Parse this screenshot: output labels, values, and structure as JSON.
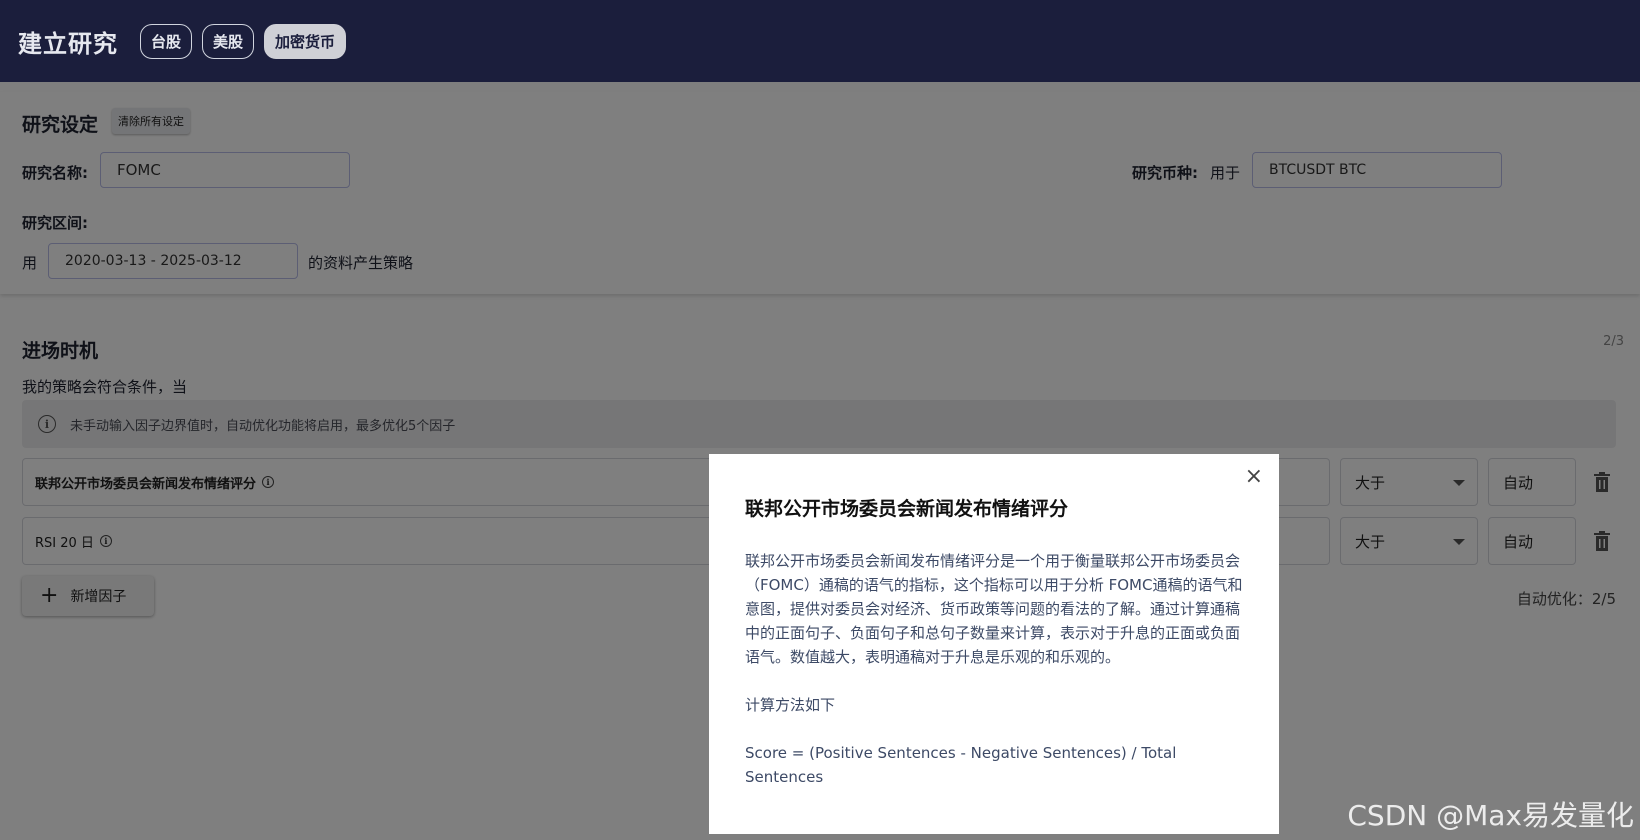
{
  "header": {
    "title": "建立研究",
    "tabs": [
      {
        "label": "台股",
        "active": false
      },
      {
        "label": "美股",
        "active": false
      },
      {
        "label": "加密货币",
        "active": true
      }
    ]
  },
  "settings": {
    "title": "研究设定",
    "clear_label": "清除所有设定",
    "name_label": "研究名称:",
    "name_value": "FOMC",
    "coin_label": "研究币种:",
    "coin_prefix": "用于",
    "coin_value": "BTCUSDT BTC",
    "range_label": "研究区间:",
    "range_prefix": "用",
    "range_value": "2020-03-13 - 2025-03-12",
    "range_suffix": "的资料产生策略"
  },
  "entry": {
    "title": "进场时机",
    "page_count": "2/3",
    "condition_text": "我的策略会符合条件，当",
    "info_text": "未手动输入因子边界值时，自动优化功能将启用，最多优化5个因子",
    "factors": [
      {
        "name": "联邦公开市场委员会新闻发布情绪评分",
        "operator": "大于",
        "value": "自动"
      },
      {
        "name": "RSI 20 日",
        "operator": "大于",
        "value": "自动"
      }
    ],
    "add_label": "新增因子",
    "auto_opt_label": "自动优化：2/5"
  },
  "modal": {
    "title": "联邦公开市场委员会新闻发布情绪评分",
    "description": "联邦公开市场委员会新闻发布情绪评分是一个用于衡量联邦公开市场委员会（FOMC）通稿的语气的指标，这个指标可以用于分析 FOMC通稿的语气和意图，提供对委员会对经济、货币政策等问题的看法的了解。通过计算通稿中的正面句子、负面句子和总句子数量来计算，表示对于升息的正面或负面语气。数值越大，表明通稿对于升息是乐观的和乐观的。",
    "method_label": "计算方法如下",
    "formula": "Score = (Positive Sentences - Negative Sentences) / Total Sentences",
    "close_symbol": "×"
  },
  "watermark": "CSDN @Max易发量化",
  "colors": {
    "header_bg": "#1b1e3c",
    "overlay": "rgba(0,0,0,0.5)",
    "modal_text": "#3d4a66"
  }
}
